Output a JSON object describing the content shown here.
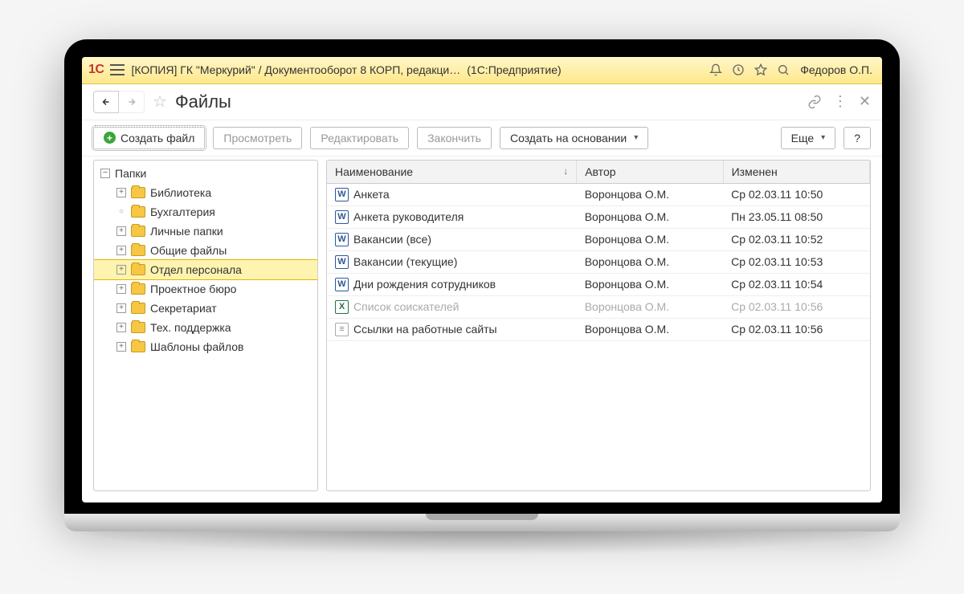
{
  "titlebar": {
    "app_title": "[КОПИЯ] ГК \"Меркурий\" / Документооборот 8 КОРП, редакци…",
    "mode": "(1С:Предприятие)",
    "username": "Федоров О.П."
  },
  "subheader": {
    "page_title": "Файлы"
  },
  "toolbar": {
    "create_file": "Создать файл",
    "view": "Просмотреть",
    "edit": "Редактировать",
    "finish": "Закончить",
    "create_on_basis": "Создать на основании",
    "more": "Еще",
    "help": "?"
  },
  "tree": {
    "root_label": "Папки",
    "nodes": [
      {
        "label": "Библиотека",
        "selected": false,
        "expandable": true
      },
      {
        "label": "Бухгалтерия",
        "selected": false,
        "expandable": false
      },
      {
        "label": "Личные папки",
        "selected": false,
        "expandable": true
      },
      {
        "label": "Общие файлы",
        "selected": false,
        "expandable": true
      },
      {
        "label": "Отдел персонала",
        "selected": true,
        "expandable": true
      },
      {
        "label": "Проектное бюро",
        "selected": false,
        "expandable": true
      },
      {
        "label": "Секретариат",
        "selected": false,
        "expandable": true
      },
      {
        "label": "Тех. поддержка",
        "selected": false,
        "expandable": true
      },
      {
        "label": "Шаблоны файлов",
        "selected": false,
        "expandable": true
      }
    ]
  },
  "table": {
    "columns": {
      "name": "Наименование",
      "author": "Автор",
      "modified": "Изменен"
    },
    "rows": [
      {
        "icon": "word",
        "name": "Анкета",
        "author": "Воронцова О.М.",
        "modified": "Ср 02.03.11 10:50",
        "dimmed": false
      },
      {
        "icon": "word",
        "name": "Анкета руководителя",
        "author": "Воронцова О.М.",
        "modified": "Пн 23.05.11 08:50",
        "dimmed": false
      },
      {
        "icon": "word",
        "name": "Вакансии (все)",
        "author": "Воронцова О.М.",
        "modified": "Ср 02.03.11 10:52",
        "dimmed": false
      },
      {
        "icon": "word",
        "name": "Вакансии (текущие)",
        "author": "Воронцова О.М.",
        "modified": "Ср 02.03.11 10:53",
        "dimmed": false
      },
      {
        "icon": "word",
        "name": "Дни рождения сотрудников",
        "author": "Воронцова О.М.",
        "modified": "Ср 02.03.11 10:54",
        "dimmed": false
      },
      {
        "icon": "excel",
        "name": "Список соискателей",
        "author": "Воронцова О.М.",
        "modified": "Ср 02.03.11 10:56",
        "dimmed": true
      },
      {
        "icon": "text",
        "name": "Ссылки на работные сайты",
        "author": "Воронцова О.М.",
        "modified": "Ср 02.03.11 10:56",
        "dimmed": false
      }
    ]
  }
}
